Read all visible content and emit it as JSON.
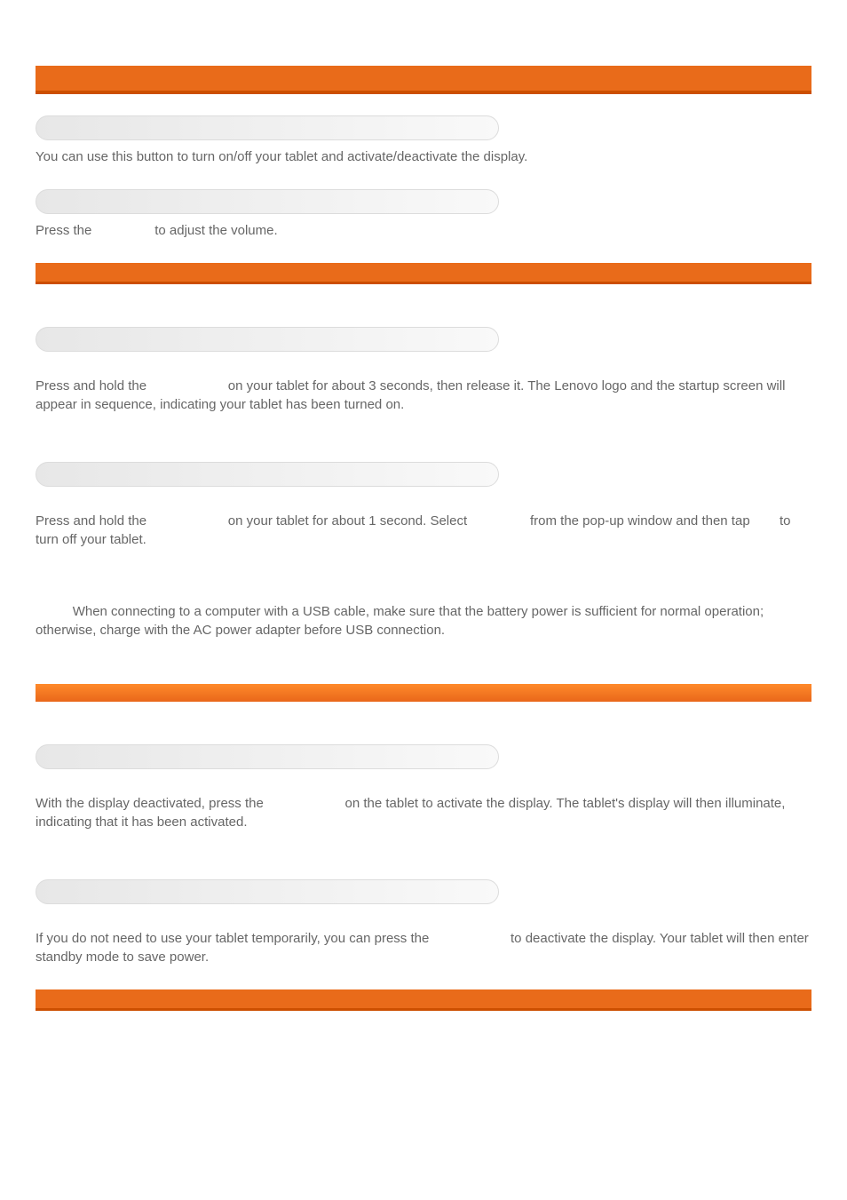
{
  "sections": {
    "keys_heading_bar": "",
    "on_off": {
      "pill": "",
      "text": "You can use this button to turn on/off your tablet and activate/deactivate the display."
    },
    "volume": {
      "pill": "",
      "pre": "Press the ",
      "post": " to adjust the volume."
    },
    "power_on": {
      "pill": "",
      "pre": "Press and hold the ",
      "post": " on your tablet for about 3 seconds, then release it. The Lenovo logo and the startup screen will appear in sequence, indicating your tablet has been turned on."
    },
    "power_off": {
      "pill": "",
      "pre": "Press and hold the ",
      "mid1": " on your tablet for about 1 second. Select ",
      "mid2": " from the pop-up window and then tap ",
      "post": " to turn off your tablet."
    },
    "note": {
      "prefix": "          ",
      "text": "When connecting to a computer with a USB cable, make sure that the battery power is sufficient for normal operation; otherwise, charge with the AC power adapter before USB connection."
    },
    "display_section_bar": "",
    "activate": {
      "pill": "",
      "pre": "With the display deactivated, press the ",
      "post": " on the tablet to activate the display. The tablet's display will then illuminate, indicating that it has been activated."
    },
    "deactivate": {
      "pill": "",
      "pre": "If you do not need to use your tablet temporarily, you can press the ",
      "post": " to deactivate the display. Your tablet will then enter standby mode to save power."
    }
  }
}
